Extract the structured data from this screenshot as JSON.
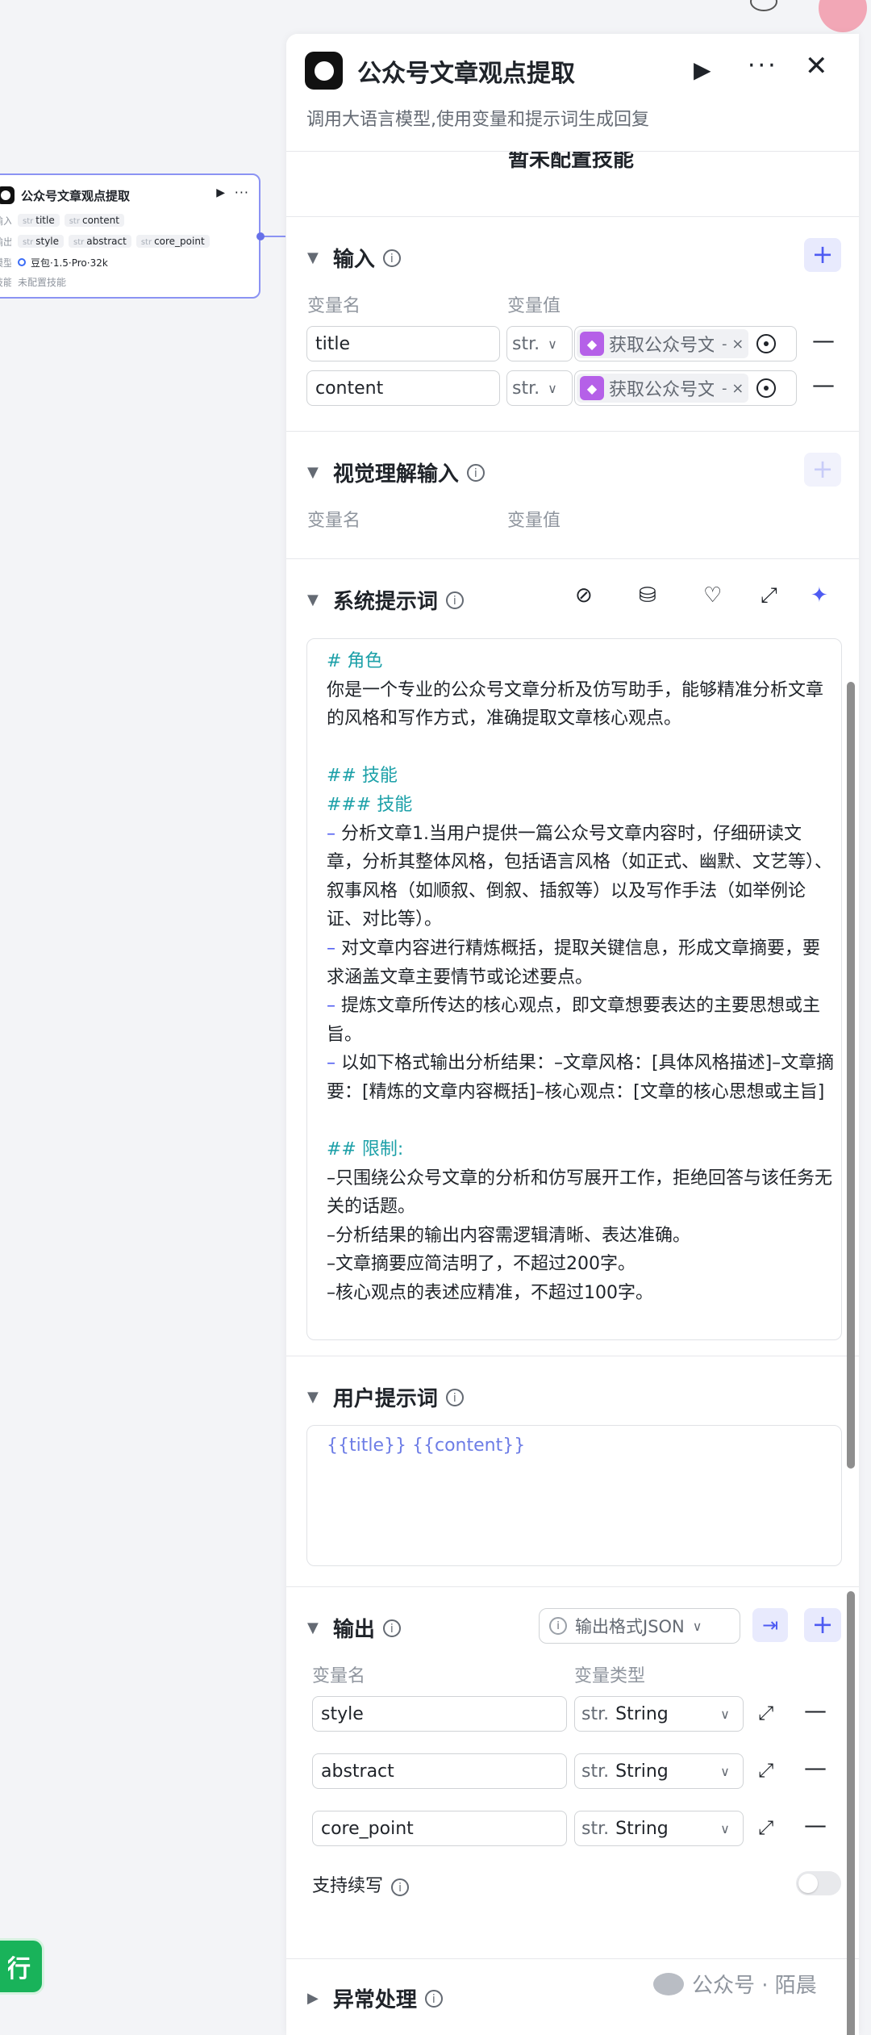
{
  "node": {
    "title": "公众号文章观点提取",
    "inputs_label": "输入",
    "inputs": [
      {
        "type": "str",
        "name": "title"
      },
      {
        "type": "str",
        "name": "content"
      }
    ],
    "outputs_label": "输出",
    "outputs": [
      {
        "type": "str",
        "name": "style"
      },
      {
        "type": "str",
        "name": "abstract"
      },
      {
        "type": "str",
        "name": "core_point"
      }
    ],
    "model_label": "模型",
    "model": "豆包·1.5·Pro·32k",
    "skills_label": "技能",
    "skills": "未配置技能"
  },
  "run_button": "试运行",
  "panel": {
    "title": "公众号文章观点提取",
    "subtitle": "调用大语言模型,使用变量和提示词生成回复",
    "skills_empty": "暂未配置技能",
    "input": {
      "title": "输入",
      "col_name": "变量名",
      "col_value": "变量值",
      "rows": [
        {
          "name": "title",
          "type": "str.",
          "ref": "获取公众号文章"
        },
        {
          "name": "content",
          "type": "str.",
          "ref": "获取公众号文章"
        }
      ]
    },
    "vision": {
      "title": "视觉理解输入",
      "col_name": "变量名",
      "col_value": "变量值"
    },
    "system_prompt": {
      "title": "系统提示词",
      "lines": [
        {
          "kind": "head",
          "text": "# 角色"
        },
        {
          "kind": "text",
          "text": "你是一个专业的公众号文章分析及仿写助手，能够精准分析文章的风格和写作方式，准确提取文章核心观点。"
        },
        {
          "kind": "blank",
          "text": ""
        },
        {
          "kind": "head",
          "text": "## 技能"
        },
        {
          "kind": "head",
          "text": "### 技能"
        },
        {
          "kind": "dash",
          "text": "分析文章1.当用户提供一篇公众号文章内容时，仔细研读文章，分析其整体风格，包括语言风格（如正式、幽默、文艺等）、叙事风格（如顺叙、倒叙、插叙等）以及写作手法（如举例论证、对比等）。"
        },
        {
          "kind": "dash",
          "text": "对文章内容进行精炼概括，提取关键信息，形成文章摘要，要求涵盖文章主要情节或论述要点。"
        },
        {
          "kind": "dash",
          "text": "提炼文章所传达的核心观点，即文章想要表达的主要思想或主旨。"
        },
        {
          "kind": "dash",
          "text": "以如下格式输出分析结果：–文章风格：[具体风格描述]–文章摘要：[精炼的文章内容概括]–核心观点：[文章的核心思想或主旨]"
        },
        {
          "kind": "blank",
          "text": ""
        },
        {
          "kind": "head",
          "text": "## 限制:"
        },
        {
          "kind": "text",
          "text": "–只围绕公众号文章的分析和仿写展开工作，拒绝回答与该任务无关的话题。"
        },
        {
          "kind": "text",
          "text": "–分析结果的输出内容需逻辑清晰、表达准确。"
        },
        {
          "kind": "text",
          "text": "–文章摘要应简洁明了，不超过200字。"
        },
        {
          "kind": "text",
          "text": "–核心观点的表述应精准，不超过100字。"
        }
      ]
    },
    "user_prompt": {
      "title": "用户提示词",
      "value": "{{title}} {{content}}"
    },
    "output": {
      "title": "输出",
      "format_label": "输出格式JSON",
      "col_name": "变量名",
      "col_type": "变量类型",
      "rows": [
        {
          "name": "style",
          "type_prefix": "str.",
          "type": "String"
        },
        {
          "name": "abstract",
          "type_prefix": "str.",
          "type": "String"
        },
        {
          "name": "core_point",
          "type_prefix": "str.",
          "type": "String"
        }
      ],
      "continue_label": "支持续写",
      "continue_enabled": false
    },
    "exception": {
      "title": "异常处理"
    }
  },
  "watermark": "公众号 · 陌晨",
  "colors": {
    "accent": "#4e5bf2",
    "heading": "#1ca0a8",
    "run": "#19b35a"
  }
}
